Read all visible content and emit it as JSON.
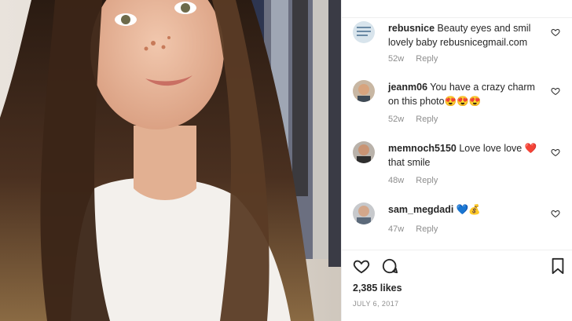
{
  "comments": [
    {
      "username": "rebusnice",
      "text": "Beauty eyes and smil lovely baby rebusnicegmail.com",
      "age": "52w",
      "reply": "Reply"
    },
    {
      "username": "jeanm06",
      "text": "You have a crazy charm on this photo😍😍😍",
      "age": "52w",
      "reply": "Reply"
    },
    {
      "username": "memnoch5150",
      "text": "Love love love ❤️ that smile",
      "age": "48w",
      "reply": "Reply"
    },
    {
      "username": "sam_megdadi",
      "text": "💙💰",
      "age": "47w",
      "reply": "Reply"
    }
  ],
  "likes": "2,385 likes",
  "date": "JULY 6, 2017",
  "icons": [
    "heart-icon",
    "comment-icon",
    "bookmark-icon"
  ],
  "colors": {
    "text": "#262626",
    "muted": "#8e8e8e",
    "border": "#efefef"
  }
}
